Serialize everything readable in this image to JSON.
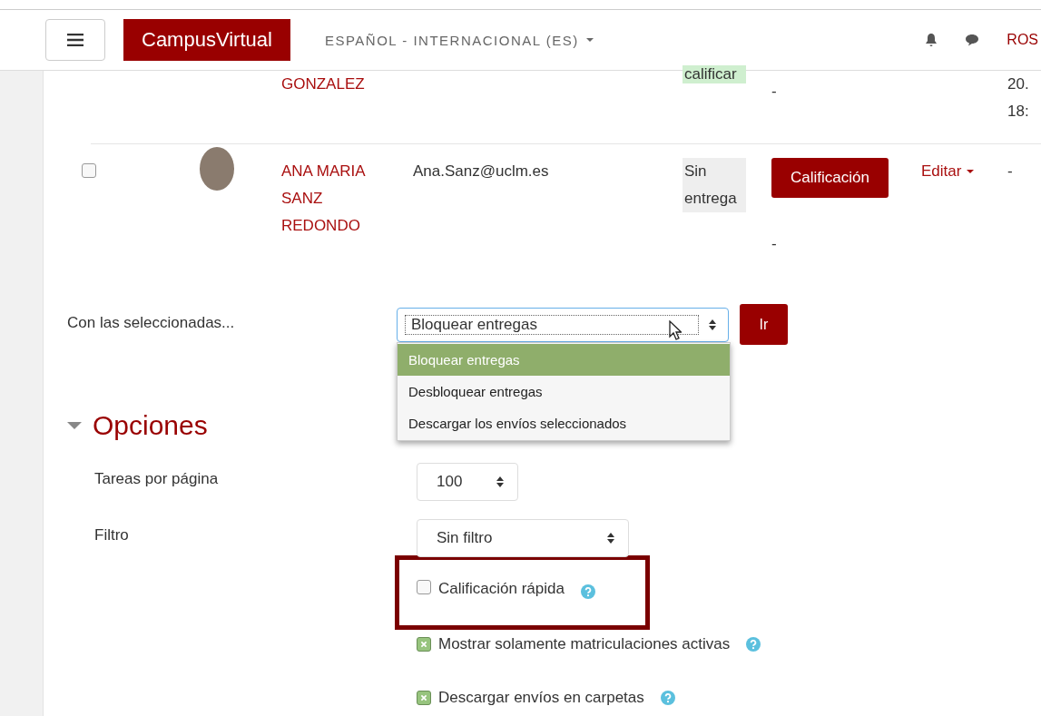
{
  "header": {
    "logo": "CampusVirtual",
    "language": "ESPAÑOL - INTERNACIONAL (ES)",
    "user": "ROS"
  },
  "table": {
    "rows": [
      {
        "kind": "partial",
        "name": "GONZALEZ",
        "status": {
          "label": "calificar",
          "kind": "submitted"
        },
        "grade_note": "-",
        "last_lines": [
          "20.",
          "18:"
        ]
      },
      {
        "kind": "full",
        "checked": false,
        "name": "ANA MARIA SANZ REDONDO",
        "email": "Ana.Sanz@uclm.es",
        "status": {
          "label": "Sin entrega",
          "kind": "none"
        },
        "grade_button": "Calificación",
        "grade_note": "-",
        "edit": "Editar",
        "last_lines": [
          "-"
        ]
      }
    ]
  },
  "bulk": {
    "label": "Con las seleccionadas...",
    "value": "Bloquear entregas",
    "go": "Ir",
    "expanded": true,
    "options": [
      {
        "label": "Bloquear entregas",
        "selected": true
      },
      {
        "label": "Desbloquear entregas",
        "selected": false
      },
      {
        "label": "Descargar los envíos seleccionados",
        "selected": false
      }
    ]
  },
  "options": {
    "title": "Opciones",
    "expanded": true,
    "fields": [
      {
        "label": "Tareas por página",
        "value": "100",
        "kind": "narrow"
      },
      {
        "label": "Filtro",
        "value": "Sin filtro",
        "kind": "wide"
      }
    ],
    "checkboxes": [
      {
        "label": "Calificación rápida",
        "checked": false,
        "highlighted": true
      },
      {
        "label": "Mostrar solamente matriculaciones activas",
        "checked": true,
        "highlighted": false
      },
      {
        "label": "Descargar envíos en carpetas",
        "checked": true,
        "highlighted": false
      }
    ]
  }
}
